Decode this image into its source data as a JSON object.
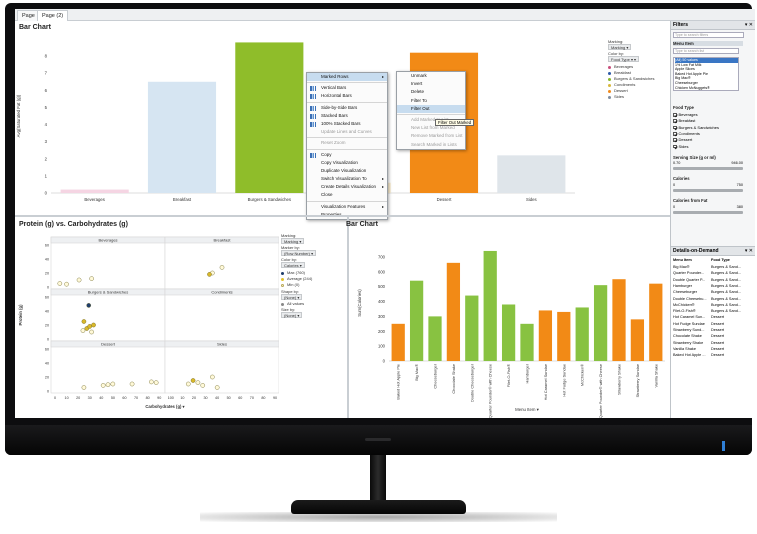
{
  "tabs": [
    "Page",
    "Page (2)"
  ],
  "top_chart": {
    "title": "Bar Chart",
    "ylabel": "Avg(Saturated Fat (g))",
    "xlabel": "Food",
    "yticks": [
      "0",
      "1",
      "2",
      "3",
      "4",
      "5",
      "6",
      "7",
      "8"
    ],
    "legend": {
      "marking_label": "Marking:",
      "marking_value": "Marking",
      "colorby_label": "Color by:",
      "colorby_value": "Food Type",
      "items": [
        {
          "label": "Beverages",
          "color": "#c94f7c"
        },
        {
          "label": "Breakfast",
          "color": "#2d5aa8"
        },
        {
          "label": "Burgers & Sandwiches",
          "color": "#88b82c"
        },
        {
          "label": "Condiments",
          "color": "#d8b83a"
        },
        {
          "label": "Dessert",
          "color": "#f08a1c"
        },
        {
          "label": "Sides",
          "color": "#7f8da0"
        }
      ]
    }
  },
  "chart_data": [
    {
      "type": "bar",
      "title": "Bar Chart",
      "ylabel": "Avg(Saturated Fat (g))",
      "xlabel": "Food",
      "categories": [
        "Beverages",
        "Breakfast",
        "Burgers & Sandwiches",
        "Condiments",
        "Dessert",
        "Sides"
      ],
      "values": [
        0.2,
        6.5,
        8.8,
        0.6,
        8.2,
        2.2
      ],
      "colors": [
        "#f5d5e3",
        "#d6e5f2",
        "#8fbd2a",
        "#fbeed0",
        "#f28a16",
        "#dfe5ea"
      ],
      "ylim": [
        0,
        9
      ]
    },
    {
      "type": "bar",
      "title": "Bar Chart",
      "ylabel": "Sum(Calories)",
      "xlabel": "Menu Item",
      "categories": [
        "Baked Hot Apple Pie",
        "Big Mac®",
        "Cheeseburger",
        "Chocolate Shake",
        "Double Cheeseburger",
        "Double Quarter Pounder® with Cheese",
        "Filet-O-Fish®",
        "Hamburger",
        "Hot Caramel Sundae",
        "Hot Fudge Sundae",
        "McChicken®",
        "Quarter Pounder® with Cheese",
        "Strawberry Shake",
        "Strawberry Sundae",
        "Vanilla Shake"
      ],
      "values": [
        250,
        540,
        300,
        660,
        440,
        740,
        380,
        250,
        340,
        330,
        360,
        510,
        550,
        280,
        520
      ],
      "colors": [
        "#f28a16",
        "#88c241",
        "#88c241",
        "#f28a16",
        "#88c241",
        "#88c241",
        "#88c241",
        "#88c241",
        "#f28a16",
        "#f28a16",
        "#88c241",
        "#88c241",
        "#f28a16",
        "#f28a16",
        "#f28a16"
      ],
      "yticks": [
        "0",
        "100",
        "200",
        "300",
        "400",
        "500",
        "600",
        "700"
      ],
      "ylim": [
        0,
        780
      ]
    },
    {
      "type": "scatter",
      "title": "Protein (g) vs. Carbohydrates (g)",
      "xlabel": "Carbohydrates (g)",
      "ylabel": "Protein (g)",
      "panels": [
        {
          "name": "Beverages",
          "points": [
            [
              5,
              5
            ],
            [
              25,
              10
            ],
            [
              38,
              12
            ],
            [
              12,
              4
            ]
          ]
        },
        {
          "name": "Breakfast",
          "points": [
            [
              45,
              20
            ],
            [
              42,
              18
            ],
            [
              55,
              28
            ]
          ]
        },
        {
          "name": "Burgers & Sandwiches",
          "points": [
            [
              35,
              48
            ],
            [
              30,
              25
            ],
            [
              40,
              20
            ],
            [
              33,
              15
            ],
            [
              36,
              18
            ],
            [
              38,
              10
            ],
            [
              29,
              12
            ]
          ]
        },
        {
          "name": "Condiments",
          "points": []
        },
        {
          "name": "Dessert",
          "points": [
            [
              30,
              5
            ],
            [
              50,
              8
            ],
            [
              60,
              10
            ],
            [
              55,
              9
            ],
            [
              80,
              10
            ],
            [
              100,
              13
            ],
            [
              105,
              12
            ]
          ]
        },
        {
          "name": "Sides",
          "points": [
            [
              20,
              10
            ],
            [
              25,
              15
            ],
            [
              30,
              12
            ],
            [
              35,
              8
            ],
            [
              45,
              20
            ],
            [
              50,
              5
            ]
          ]
        }
      ],
      "xticks": [
        "0",
        "10",
        "20",
        "30",
        "40",
        "50",
        "60",
        "70",
        "80",
        "90",
        "100",
        "10",
        "20",
        "30",
        "40",
        "50",
        "60",
        "70",
        "80",
        "90"
      ],
      "yticks": [
        "0",
        "10",
        "20",
        "30",
        "40",
        "50",
        "60"
      ]
    }
  ],
  "context_menu": {
    "items": [
      {
        "label": "Marked Rows",
        "submenu": true,
        "hl": true
      },
      {
        "sep": true
      },
      {
        "label": "Vertical Bars",
        "icon": true
      },
      {
        "label": "Horizontal Bars",
        "icon": true
      },
      {
        "sep": true
      },
      {
        "label": "Side-by-Side Bars",
        "icon": true
      },
      {
        "label": "Stacked Bars",
        "icon": true
      },
      {
        "label": "100% Stacked Bars",
        "icon": true
      },
      {
        "label": "Update Lines and Curves",
        "disabled": true
      },
      {
        "sep": true
      },
      {
        "label": "Reset Zoom",
        "disabled": true
      },
      {
        "sep": true
      },
      {
        "label": "Copy",
        "icon": true
      },
      {
        "label": "Copy Visualization"
      },
      {
        "label": "Duplicate Visualization"
      },
      {
        "label": "Switch Visualization To",
        "submenu": true
      },
      {
        "label": "Create Details Visualization",
        "submenu": true
      },
      {
        "label": "Close"
      },
      {
        "sep": true
      },
      {
        "label": "Visualization Features",
        "submenu": true
      },
      {
        "label": "Properties"
      }
    ],
    "submenu": [
      {
        "label": "Unmark"
      },
      {
        "label": "Invert"
      },
      {
        "label": "Delete"
      },
      {
        "label": "Filter To"
      },
      {
        "label": "Filter Out",
        "hl": true
      },
      {
        "sep": true
      },
      {
        "label": "Add Marked to List",
        "disabled": true
      },
      {
        "label": "New List from Marked",
        "disabled": true
      },
      {
        "label": "Remove Marked from List",
        "disabled": true
      },
      {
        "label": "Search Marked in Lists",
        "disabled": true
      }
    ],
    "tooltip": "Filter Out Marked"
  },
  "scatter_legend": {
    "marking_label": "Marking:",
    "marking_value": "Marking",
    "markerby_label": "Marker by:",
    "markerby_value": "(Row Number)",
    "colorby_label": "Color by:",
    "colorby_value": "Calories",
    "max": "Max (760)",
    "avg": "Average (244)",
    "min": "Min (0)",
    "shapeby_label": "Shape by:",
    "shapeby_value": "(None)",
    "all_values": "All values",
    "sizeby_label": "Size by:",
    "sizeby_value": "(None)"
  },
  "filters": {
    "header": "Filters",
    "search_placeholder": "Type to search filters",
    "menu_item_label": "Menu Item",
    "menu_search_placeholder": "Type to search list",
    "menu_list": [
      "(All) 50 values",
      "1% Low Fat Milk",
      "Apple Slices",
      "Baked Hot Apple Pie",
      "Big Mac®",
      "Cheeseburger",
      "Chicken McNuggets®"
    ],
    "food_type_label": "Food Type",
    "food_types": [
      "Beverages",
      "Breakfast",
      "Burgers & Sandwiches",
      "Condiments",
      "Dessert",
      "Sides"
    ],
    "serving_label": "Serving Size (g or ml)",
    "serving_min": "0.70",
    "serving_max": "946.00",
    "calories_label": "Calories",
    "calories_min": "0",
    "calories_max": "750",
    "calfat_label": "Calories from Fat",
    "calfat_min": "0",
    "calfat_max": "380"
  },
  "details": {
    "header": "Details-on-Demand",
    "col1": "Menu Item",
    "col2": "Food Type",
    "rows": [
      [
        "Big Mac®",
        "Burgers & Sand..."
      ],
      [
        "Quarter Pounder...",
        "Burgers & Sand..."
      ],
      [
        "Double Quarter P...",
        "Burgers & Sand..."
      ],
      [
        "Hamburger",
        "Burgers & Sand..."
      ],
      [
        "Cheeseburger",
        "Burgers & Sand..."
      ],
      [
        "Double Cheesebu...",
        "Burgers & Sand..."
      ],
      [
        "McChicken®",
        "Burgers & Sand..."
      ],
      [
        "Filet-O-Fish®",
        "Burgers & Sand..."
      ],
      [
        "Hot Caramel Sun...",
        "Dessert"
      ],
      [
        "Hot Fudge Sundae",
        "Dessert"
      ],
      [
        "Strawberry Sund...",
        "Dessert"
      ],
      [
        "Chocolate Shake",
        "Dessert"
      ],
      [
        "Strawberry Shake",
        "Dessert"
      ],
      [
        "Vanilla Shake",
        "Dessert"
      ],
      [
        "Baked Hot Apple ...",
        "Dessert"
      ]
    ]
  },
  "scatter_title": "Protein (g) vs. Carbohydrates (g)",
  "bottom_title": "Bar Chart",
  "bottom_xlabel": "Menu Item",
  "bottom_ylabel": "Sum(Calories)",
  "scatter_xlabel": "Carbohydrates (g)",
  "scatter_ylabel": "Protein (g)"
}
